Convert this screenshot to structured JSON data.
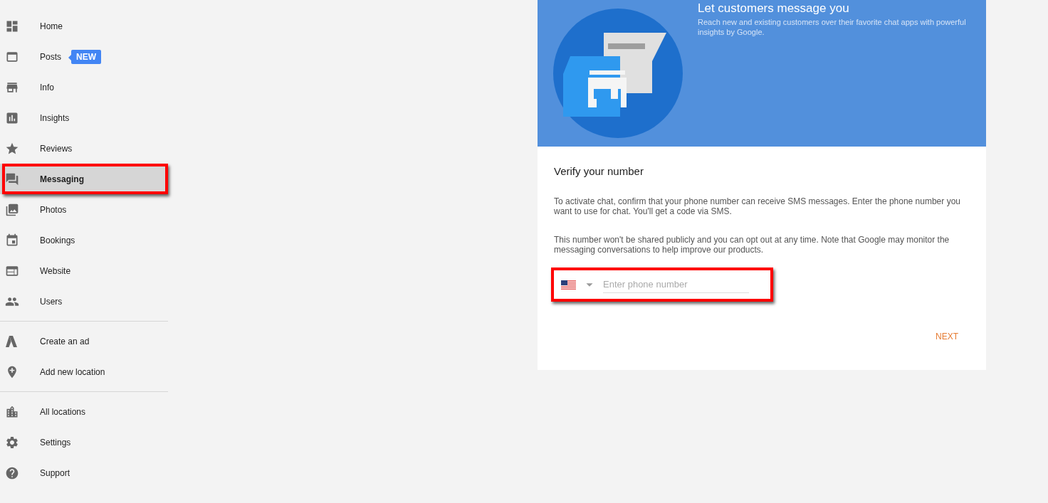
{
  "sidebar": {
    "groups": [
      {
        "items": [
          {
            "label": "Home",
            "selected": false,
            "highlighted": false
          },
          {
            "label": "Posts",
            "selected": false,
            "highlighted": false,
            "badge": "NEW"
          },
          {
            "label": "Info",
            "selected": false,
            "highlighted": false
          },
          {
            "label": "Insights",
            "selected": false,
            "highlighted": false
          },
          {
            "label": "Reviews",
            "selected": false,
            "highlighted": false
          },
          {
            "label": "Messaging",
            "selected": true,
            "highlighted": true
          },
          {
            "label": "Photos",
            "selected": false,
            "highlighted": false
          },
          {
            "label": "Bookings",
            "selected": false,
            "highlighted": false
          },
          {
            "label": "Website",
            "selected": false,
            "highlighted": false
          },
          {
            "label": "Users",
            "selected": false,
            "highlighted": false
          }
        ]
      },
      {
        "items": [
          {
            "label": "Create an ad",
            "selected": false,
            "highlighted": false
          },
          {
            "label": "Add new location",
            "selected": false,
            "highlighted": false
          }
        ]
      },
      {
        "items": [
          {
            "label": "All locations",
            "selected": false,
            "highlighted": false
          },
          {
            "label": "Settings",
            "selected": false,
            "highlighted": false
          },
          {
            "label": "Support",
            "selected": false,
            "highlighted": false
          }
        ]
      }
    ]
  },
  "banner": {
    "title": "Let customers message you",
    "subtitle": "Reach new and existing customers over their favorite chat apps with powerful insights by Google."
  },
  "verify": {
    "title": "Verify your number",
    "paragraphs": [
      "To activate chat, confirm that your phone number can receive SMS messages. Enter the phone number you want to use for chat. You'll get a code via SMS.",
      "This number won't be shared publicly and you can opt out at any time. Note that Google may monitor the messaging conversations to help improve our products."
    ],
    "phone_field": {
      "placeholder": "Enter phone number",
      "highlighted": true
    },
    "next_button": "NEXT"
  }
}
